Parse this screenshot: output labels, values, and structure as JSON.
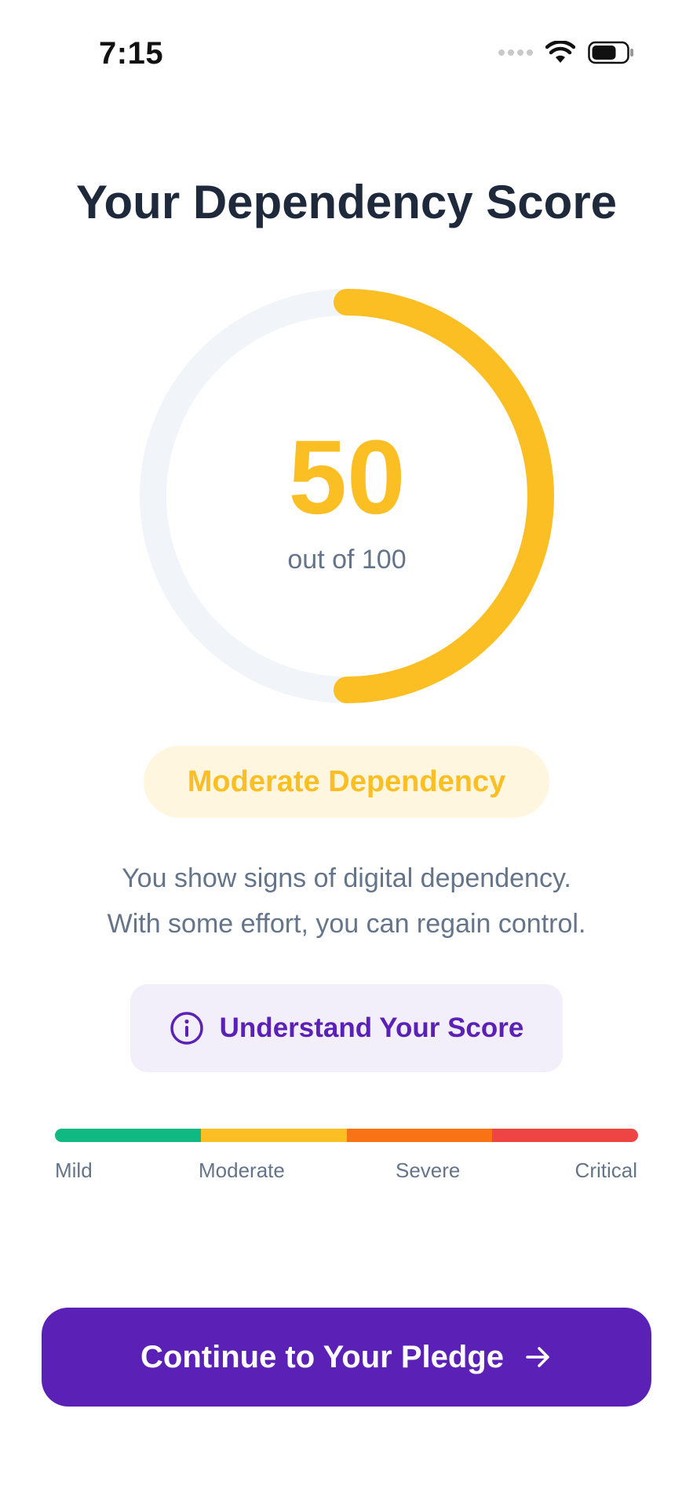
{
  "status_bar": {
    "time": "7:15"
  },
  "title": "Your Dependency Score",
  "score": {
    "value": "50",
    "subtitle": "out of 100",
    "fraction": 0.5
  },
  "badge": {
    "label": "Moderate Dependency"
  },
  "description": {
    "line1": "You show signs of digital dependency.",
    "line2": "With some effort, you can regain control."
  },
  "understand_button": {
    "label": "Understand Your Score",
    "icon": "info-icon"
  },
  "scale": {
    "levels": [
      {
        "label": "Mild",
        "color": "#10b981"
      },
      {
        "label": "Moderate",
        "color": "#fbbf24"
      },
      {
        "label": "Severe",
        "color": "#f97316"
      },
      {
        "label": "Critical",
        "color": "#ef4444"
      }
    ]
  },
  "cta": {
    "label": "Continue to Your Pledge",
    "icon": "arrow-right-icon"
  },
  "colors": {
    "accent": "#fbbf24",
    "track": "#f1f4f9",
    "primary": "#5b21b6",
    "badge_bg": "#fef6df",
    "info_bg": "#f3effa",
    "text_dark": "#1e293b",
    "text_muted": "#64748b"
  }
}
